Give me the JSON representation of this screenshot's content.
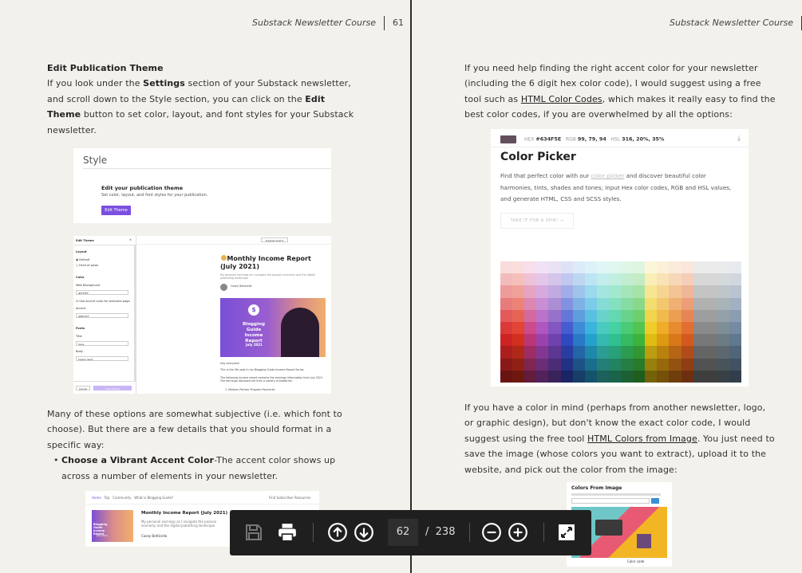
{
  "left_page": {
    "running_head": "Substack Newsletter Course",
    "page_number": "61",
    "heading": "Edit Publication Theme",
    "para1_a": "If you look under the ",
    "para1_b": "Settings",
    "para1_c": " section of your Substack newsletter, and scroll down to the Style section, you can click on the ",
    "para1_d": "Edit Theme",
    "para1_e": " button to set color, layout, and font styles for your Substack newsletter.",
    "para2": "Many of these options are somewhat subjective (i.e. which font to choose). But there are a few details that you should format in a specific way:",
    "bullet_bold": "Choose a Vibrant Accent Color",
    "bullet_rest": "-The accent color shows up across a number of elements in your newsletter.",
    "style_shot": {
      "title": "Style",
      "heading": "Edit your publication theme",
      "sub": "Set color, layout, and font styles for your publication.",
      "button": "Edit Theme"
    },
    "editor_shot": {
      "header": "Edit Theme",
      "preview": "Preview: Post ▾",
      "layout": "Layout",
      "opt1": "Default",
      "opt2": "Feed of posts",
      "color": "Color",
      "bg_label": "Web Background",
      "bg_value": "#FFFFFF",
      "accent_check": "Use accent color for welcome page",
      "accent_label": "Accent",
      "accent_value": "#8E53FF",
      "fonts": "Fonts",
      "title_label": "Title",
      "title_value": "Sans",
      "body_label": "Body",
      "body_value": "Classic Serif",
      "cancel": "Cancel",
      "save": "Save theme",
      "article_title": "Monthly Income Report (July 2021)",
      "article_sub": "My personal earnings as I navigate the passion economy and the digital publishing landscape",
      "author": "Casey Botticello",
      "hero_text": "Blogging Guide Income Report",
      "hero_year": "July 2021",
      "hero_coin": "$",
      "p1": "Hey everyone!",
      "p2": "This is the 5th post in my Blogging Guide Income Report Series.",
      "p3": "The following income report contains the earnings information from July 2021. The earnings disclosed are from a variety of platforms:",
      "p4": "1. Medium Partner Program Payments"
    },
    "preview_shot": {
      "nav1": "Home",
      "nav2": "Top",
      "nav3": "Community",
      "nav4": "What is Blogging Guide?",
      "right_link": "Find Subscriber Resources",
      "title": "Monthly Income Report (July 2021)",
      "sub": "My personal earnings as I navigate the passion economy and the digital publishing landscape",
      "author": "Casey Botticello",
      "thumb_text": "Blogging Guide Income Report",
      "thumb_year": "July 2021"
    }
  },
  "right_page": {
    "running_head": "Substack Newsletter Course",
    "page_number": "62",
    "para1_a": "If you need help finding the right accent color for your newsletter (including the 6 digit hex color code), I would suggest using a free tool such as ",
    "para1_link": "HTML Color Codes",
    "para1_b": ", which makes it really easy to find the best color codes, if you are overwhelmed by all the options:",
    "para2_a": "If you have a color in mind (perhaps from another newsletter, logo, or graphic design), but don't know the exact color code, I would suggest using the free tool ",
    "para2_link": "HTML Colors from Image",
    "para2_b": ". You just need to save the image (whose colors you want to extract), upload it to the website, and pick out the color from the image:",
    "picker": {
      "hex_label": "HEX",
      "hex": "#634F5E",
      "rgb_label": "RGB",
      "rgb": "99, 79, 94",
      "hsl_label": "HSL",
      "hsl": "316, 20%, 35%",
      "swatch_color": "#634f5e",
      "title": "Color Picker",
      "desc_a": "Find that perfect color with our ",
      "desc_link": "color picker",
      "desc_b": " and discover beautiful color harmonies, tints, shades and tones; input Hex color codes, RGB and HSL values, and generate HTML, CSS and SCSS styles.",
      "button": "TAKE IT FOR A SPIN! →"
    },
    "cfi": {
      "title": "Colors From Image",
      "color_code": "Color code"
    }
  },
  "toolbar": {
    "current_page": "62",
    "separator": "/",
    "total_pages": "238"
  }
}
